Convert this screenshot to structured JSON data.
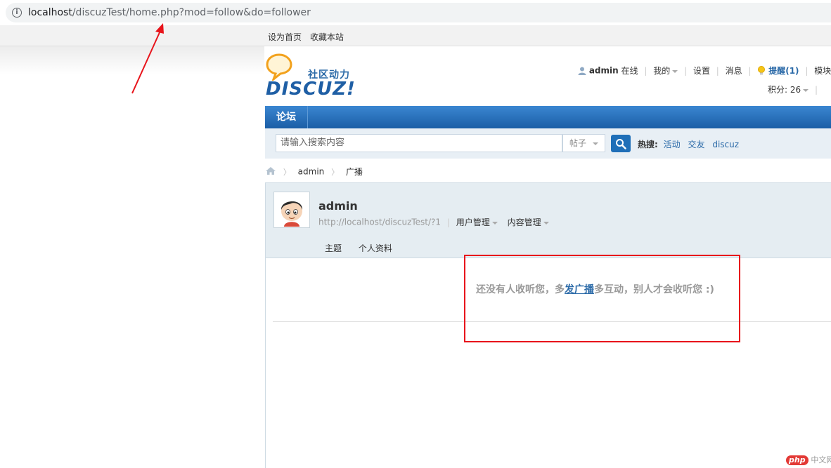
{
  "browser": {
    "url_host": "localhost",
    "url_rest": "/discuzTest/home.php?mod=follow&do=follower"
  },
  "toptb": {
    "set_home": "设为首页",
    "favorite": "收藏本站"
  },
  "logo": {
    "slogan": "社区动力",
    "wordmark": "DISCUZ!"
  },
  "user_menu": {
    "username": "admin",
    "status": "在线",
    "mine": "我的",
    "settings": "设置",
    "messages": "消息",
    "remind": "提醒(1)",
    "module_mgmt": "模块管理",
    "points": "积分: 26"
  },
  "nav": {
    "forum": "论坛"
  },
  "search": {
    "placeholder": "请输入搜索内容",
    "type": "帖子",
    "hot_label": "热搜:",
    "hot_terms": [
      "活动",
      "交友",
      "discuz"
    ]
  },
  "breadcrumb": {
    "user": "admin",
    "current": "广播"
  },
  "profile": {
    "name": "admin",
    "url": "http://localhost/discuzTest/?1",
    "user_mgmt": "用户管理",
    "content_mgmt": "内容管理",
    "tabs": [
      "主题",
      "个人资料"
    ]
  },
  "content": {
    "empty_before": "还没有人收听您，多",
    "empty_link": "发广播",
    "empty_after": "多互动，别人才会收听您 :)"
  },
  "watermark": {
    "badge": "php",
    "text": "中文网"
  },
  "colors": {
    "nav_blue": "#1f6fb8",
    "link_blue": "#2b6aa8",
    "annotation_red": "#e8141b"
  }
}
